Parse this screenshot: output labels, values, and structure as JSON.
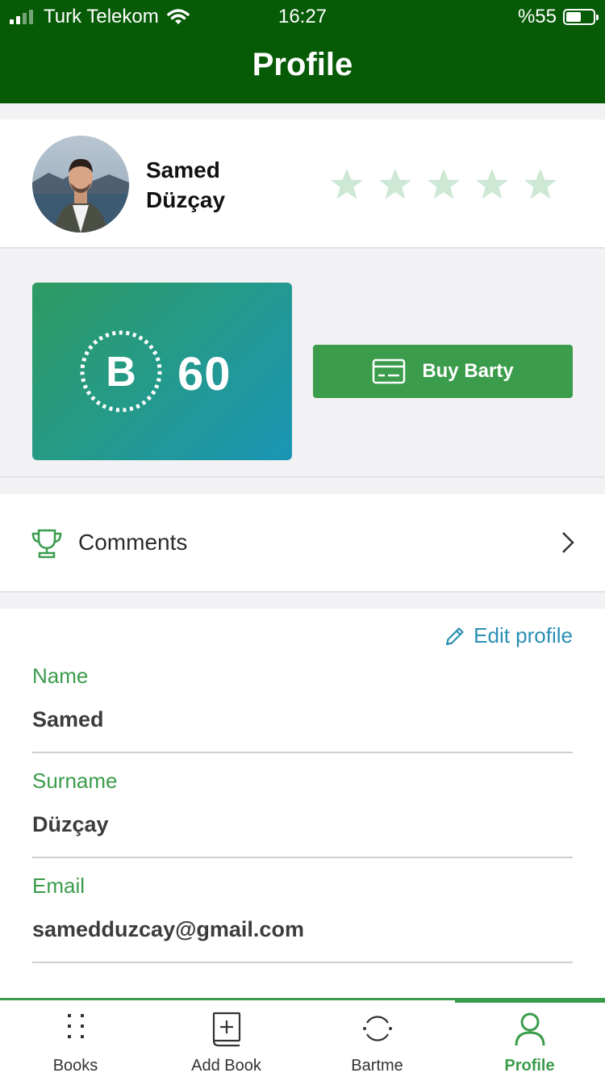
{
  "status_bar": {
    "carrier": "Turk Telekom",
    "time": "16:27",
    "battery_percent": "%55",
    "battery_level": 0.55,
    "signal_bars": 4,
    "signal_bars_active": 2
  },
  "header": {
    "title": "Profile",
    "color": "#075b07"
  },
  "user": {
    "first_name_line": "Samed",
    "last_name_line": "Düzçay",
    "rating_stars": 5,
    "rating_filled": 0,
    "star_color": "#cde8d5"
  },
  "wallet": {
    "coin_symbol": "B",
    "balance": "60",
    "buy_label": "Buy Barty"
  },
  "comments": {
    "label": "Comments"
  },
  "form": {
    "edit_label": "Edit profile",
    "fields": [
      {
        "label": "Name",
        "value": "Samed"
      },
      {
        "label": "Surname",
        "value": "Düzçay"
      },
      {
        "label": "Email",
        "value": "samedduzcay@gmail.com"
      }
    ]
  },
  "tabs": [
    {
      "label": "Books",
      "icon": "grid-icon",
      "active": false
    },
    {
      "label": "Add Book",
      "icon": "add-book-icon",
      "active": false
    },
    {
      "label": "Bartme",
      "icon": "exchange-icon",
      "active": false
    },
    {
      "label": "Profile",
      "icon": "person-icon",
      "active": true
    }
  ],
  "colors": {
    "accent": "#3b9c4b",
    "link": "#2a8fb4"
  }
}
